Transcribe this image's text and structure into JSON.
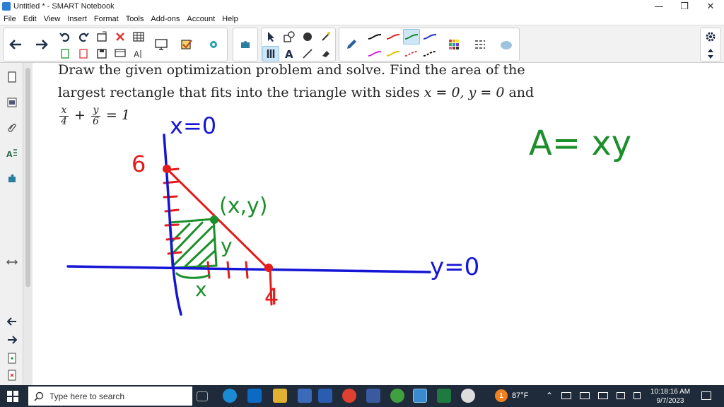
{
  "window": {
    "title": "Untitled * - SMART Notebook",
    "controls": {
      "minimize": "—",
      "restore": "❐",
      "close": "✕"
    }
  },
  "menu": [
    "File",
    "Edit",
    "View",
    "Insert",
    "Format",
    "Tools",
    "Add-ons",
    "Account",
    "Help"
  ],
  "toolbar": {
    "pen_colors": [
      "#111111",
      "#e02020",
      "#1a8a2a",
      "#2030d0",
      "#d020d0",
      "#e0c000",
      "#e04040",
      "#111111"
    ],
    "selected_pen": 2
  },
  "canvas": {
    "problem_line1": "Draw the given optimization problem and solve. Find the area of the",
    "problem_line2_a": "largest rectangle that fits into the triangle with sides",
    "problem_eq1": "x = 0, y = 0",
    "problem_and": "and",
    "frac1_num": "x",
    "frac1_den": "4",
    "frac_plus": "+",
    "frac2_num": "y",
    "frac2_den": "6",
    "frac_eq": "= 1",
    "handwriting": {
      "x_axis_label": "x=0",
      "y_axis_label": "y=0",
      "y_intercept": "6",
      "x_intercept": "4",
      "point_label": "(x,y)",
      "rect_width": "x",
      "rect_height": "y",
      "area_formula": "A= xy"
    },
    "colors": {
      "blue": "#1515d6",
      "red": "#e31b1b",
      "green": "#1b8f2a"
    }
  },
  "taskbar": {
    "search_placeholder": "Type here to search",
    "weather": "87°F",
    "time": "10:18:16 AM",
    "date": "9/7/2023",
    "weather_badge": "1"
  }
}
